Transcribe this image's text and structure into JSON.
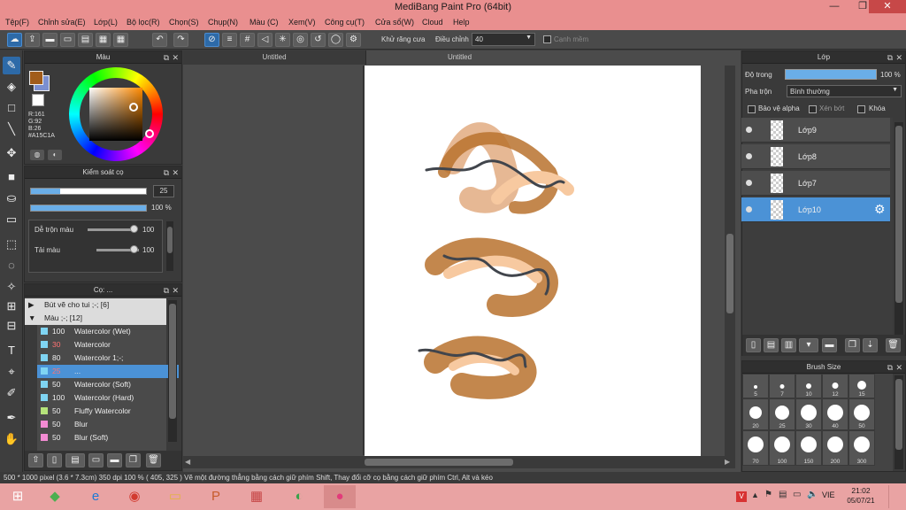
{
  "app": {
    "title": "MediBang Paint Pro (64bit)",
    "win_min": "—",
    "win_max": "❐",
    "win_close": "✕"
  },
  "menu": [
    "Tệp(F)",
    "Chỉnh sửa(E)",
    "Lớp(L)",
    "Bộ lọc(R)",
    "Chọn(S)",
    "Chụp(N)",
    "Màu (C)",
    "Xem(V)",
    "Công cụ(T)",
    "Cửa sổ(W)",
    "Cloud",
    "Help"
  ],
  "toolbar": {
    "antialias_label": "Khử răng cưa",
    "antialias_checked": true,
    "correction_label": "Điều chỉnh",
    "correction_value": "40",
    "soft_edge_label": "Cạnh mềm",
    "soft_edge_checked": false
  },
  "color_panel": {
    "title": "Màu",
    "r": "R:161",
    "g": "G:92",
    "b": "B:26",
    "hex": "#A15C1A",
    "primary_color": "#a15c1a",
    "secondary_color": "#7b8fd0"
  },
  "brush_control": {
    "title": "Kiểm soát cọ",
    "size_value": "25",
    "opacity_value": "100 %",
    "size_fraction": 0.25,
    "opacity_fraction": 1.0,
    "blend_label": "Dễ trộn màu",
    "blend_value": "100",
    "reload_label": "Tải màu",
    "reload_value": "100"
  },
  "brush_panel": {
    "title": "Cọ: ...",
    "groups": [
      {
        "label": "Bút vẽ cho tui ;-; [6]",
        "expanded": false
      },
      {
        "label": "Màu ;-; [12]",
        "expanded": true
      }
    ],
    "items": [
      {
        "size": "100",
        "name": "Watercolor (Wet)",
        "color": "#7fd4f2",
        "size_color": "#eeeeee"
      },
      {
        "size": "30",
        "name": "Watercolor",
        "color": "#7fd4f2",
        "size_color": "#ff7373"
      },
      {
        "size": "80",
        "name": "Watercolor 1;-;",
        "color": "#7fd4f2",
        "size_color": "#eeeeee"
      },
      {
        "size": "25",
        "name": "...",
        "color": "#7fd4f2",
        "size_color": "#ff7373",
        "selected": true
      },
      {
        "size": "50",
        "name": "Watercolor (Soft)",
        "color": "#7fd4f2",
        "size_color": "#eeeeee"
      },
      {
        "size": "100",
        "name": "Watercolor (Hard)",
        "color": "#7fd4f2",
        "size_color": "#eeeeee"
      },
      {
        "size": "50",
        "name": "Fluffy Watercolor",
        "color": "#b5e37a",
        "size_color": "#eeeeee"
      },
      {
        "size": "50",
        "name": "Blur",
        "color": "#f28bd2",
        "size_color": "#eeeeee"
      },
      {
        "size": "50",
        "name": "Blur (Soft)",
        "color": "#f28bd2",
        "size_color": "#eeeeee"
      }
    ]
  },
  "document": {
    "tabs": [
      "Untitled",
      "Untitled"
    ]
  },
  "layer_panel": {
    "title": "Lớp",
    "opacity_label": "Độ trong",
    "opacity_value": "100 %",
    "blend_label": "Pha trộn",
    "blend_value": "Bình thường",
    "protect_alpha": "Bảo vệ alpha",
    "clipping": "Xén bớt",
    "lock": "Khóa",
    "layers": [
      {
        "name": "Lớp9",
        "selected": false
      },
      {
        "name": "Lớp8",
        "selected": false
      },
      {
        "name": "Lớp7",
        "selected": false
      },
      {
        "name": "Lớp10",
        "selected": true
      }
    ]
  },
  "brush_size_panel": {
    "title": "Brush Size",
    "sizes": [
      "5",
      "7",
      "10",
      "12",
      "15",
      "20",
      "25",
      "30",
      "40",
      "50",
      "70",
      "100",
      "150",
      "200",
      "300"
    ]
  },
  "status": {
    "text": "500 * 1000 pixel   (3.6 * 7.3cm)   350 dpi   100 %   ( 405, 325 )   Vẽ một đường thẳng bằng cách giữ phím Shift, Thay đổi cỡ cọ bằng cách giữ phím Ctrl, Alt và kéo"
  },
  "taskbar": {
    "lang": "VIE",
    "time": "21:02",
    "date": "05/07/21"
  }
}
